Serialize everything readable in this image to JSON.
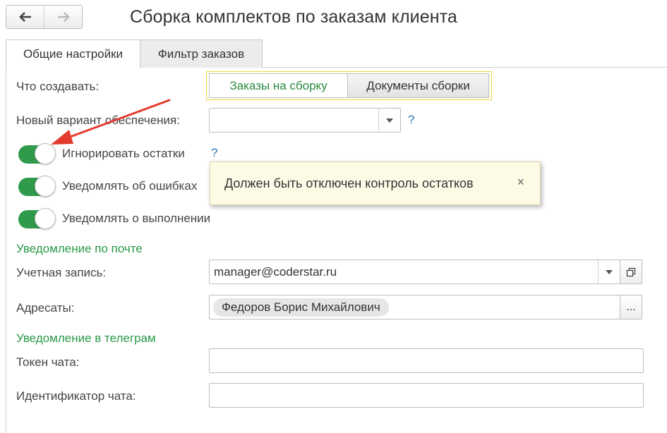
{
  "window": {
    "title": "Сборка комплектов по заказам клиента"
  },
  "nav": {
    "back_icon": "arrow-left-icon",
    "forward_icon": "arrow-right-icon"
  },
  "tabs": [
    {
      "label": "Общие настройки",
      "active": true
    },
    {
      "label": "Фильтр заказов",
      "active": false
    }
  ],
  "form": {
    "what_to_create": {
      "label": "Что создавать:",
      "options": [
        "Заказы на сборку",
        "Документы сборки"
      ],
      "selected": "Заказы на сборку"
    },
    "new_supply_variant": {
      "label": "Новый вариант обеспечения:",
      "value": "",
      "help": "?"
    },
    "ignore_stock": {
      "label": "Игнорировать остатки",
      "on": true,
      "help": "?"
    },
    "notify_errors": {
      "label": "Уведомлять об ошибках",
      "on": true
    },
    "notify_done": {
      "label": "Уведомлять о выполнении",
      "on": true
    },
    "email_section": {
      "title": "Уведомление по почте",
      "account": {
        "label": "Учетная запись:",
        "value": "manager@coderstar.ru"
      },
      "recipients": {
        "label": "Адресаты:",
        "chips": [
          "Федоров Борис Михайлович"
        ],
        "more": "..."
      }
    },
    "telegram_section": {
      "title": "Уведомление в телеграм",
      "token": {
        "label": "Токен чата:",
        "value": ""
      },
      "chat_id": {
        "label": "Идентификатор чата:",
        "value": ""
      }
    }
  },
  "tooltip": {
    "text": "Должен быть отключен контроль остатков",
    "close": "×"
  },
  "colors": {
    "accent_green": "#2e9a4a",
    "section_green": "#2a9a48",
    "help_blue": "#2a76b8",
    "arrow_red": "#e23a2e"
  }
}
